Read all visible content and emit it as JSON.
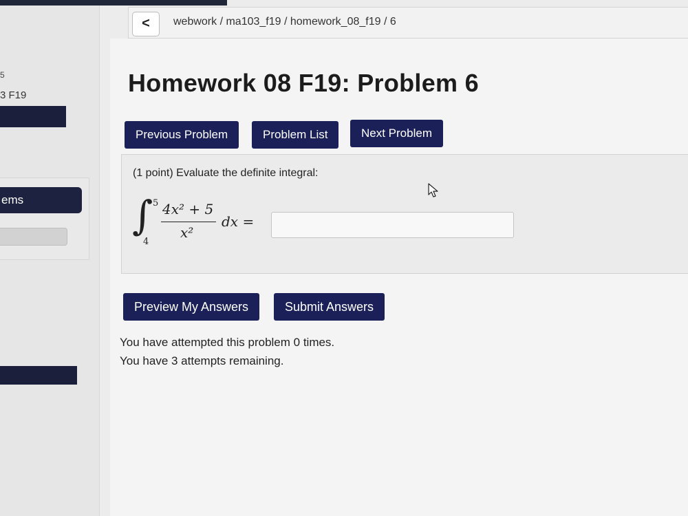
{
  "sidebar": {
    "number_fragment": "5",
    "course_fragment": "3 F19",
    "items_fragment": "ems"
  },
  "breadcrumb": {
    "back_glyph": "<",
    "path": "webwork / ma103_f19 / homework_08_f19 / 6"
  },
  "page_title": "Homework 08 F19: Problem 6",
  "nav": {
    "previous_label": "Previous Problem",
    "list_label": "Problem List",
    "next_label": "Next Problem"
  },
  "problem": {
    "prompt": "(1 point) Evaluate the definite integral:",
    "integral": {
      "sign": "∫",
      "upper_limit": "5",
      "lower_limit": "4",
      "numerator": "4x² + 5",
      "denominator": "x²",
      "differential": "dx ="
    },
    "answer_value": ""
  },
  "actions": {
    "preview_label": "Preview My Answers",
    "submit_label": "Submit Answers"
  },
  "attempts": {
    "line1": "You have attempted this problem 0 times.",
    "line2": "You have 3 attempts remaining."
  },
  "colors": {
    "button_bg": "#1b2158",
    "sidebar_dark": "#1b1f3b"
  }
}
